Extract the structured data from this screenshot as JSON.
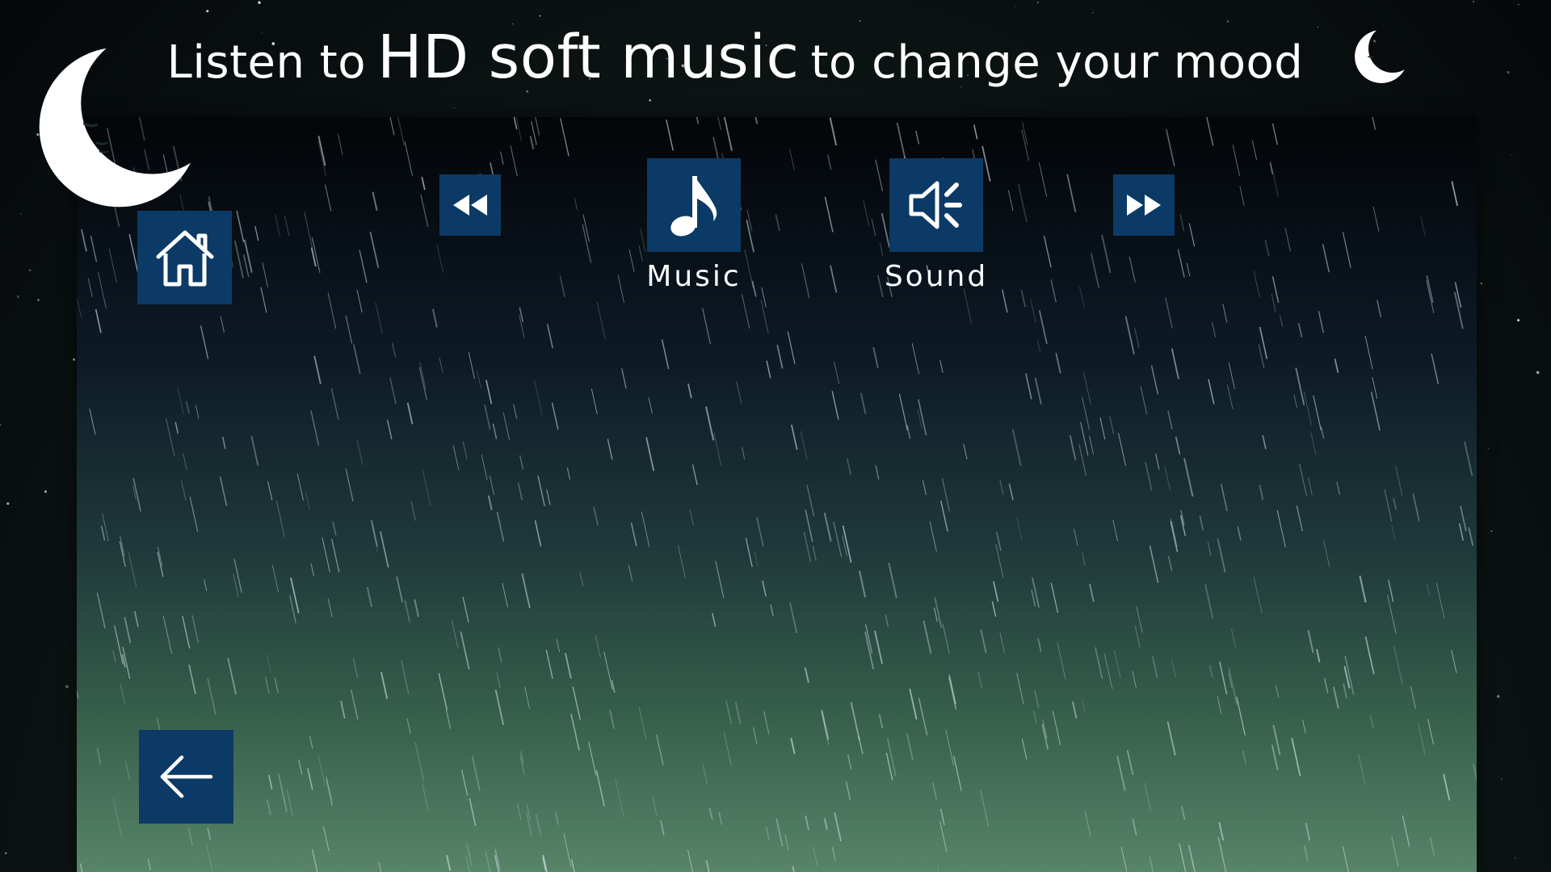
{
  "header": {
    "title_part1": "Listen to",
    "title_part2": "HD soft music",
    "title_part3": "to change your mood"
  },
  "controls": {
    "music_label": "Music",
    "sound_label": "Sound"
  },
  "icons": {
    "logo": "crescent-moon-face-icon",
    "night_mode": "crescent-moon-face-icon",
    "home": "house-icon",
    "rewind": "rewind-icon",
    "music": "music-note-icon",
    "sound": "speaker-icon",
    "fast_forward": "fast-forward-icon",
    "back": "arrow-left-icon"
  },
  "colors": {
    "tile": "#0b3a66",
    "text": "#ffffff",
    "panel_top": "#030507",
    "panel_bottom": "#58846a",
    "background": "#0a0f12"
  }
}
